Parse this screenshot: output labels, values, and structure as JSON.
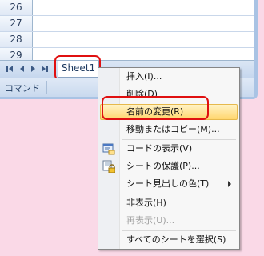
{
  "rows": [
    "26",
    "27",
    "28",
    "29"
  ],
  "nav": [
    "first",
    "prev",
    "next",
    "last"
  ],
  "sheet_tab": "Sheet1",
  "status_bar": {
    "label": "コマンド"
  },
  "menu": {
    "items": [
      {
        "label": "挿入(I)...",
        "icon": ""
      },
      {
        "label": "削除(D)",
        "icon": ""
      },
      {
        "label": "名前の変更(R)",
        "icon": "",
        "highlighted": true
      },
      {
        "label": "移動またはコピー(M)...",
        "icon": ""
      },
      {
        "label": "コードの表示(V)",
        "icon": "view-code-icon"
      },
      {
        "label": "シートの保護(P)...",
        "icon": "protect-sheet-icon"
      },
      {
        "label": "シート見出しの色(T)",
        "icon": "",
        "submenu": true
      },
      {
        "label": "非表示(H)",
        "icon": ""
      },
      {
        "label": "再表示(U)...",
        "icon": "",
        "disabled": true
      },
      {
        "label": "すべてのシートを選択(S)",
        "icon": ""
      }
    ]
  },
  "colors": {
    "background": "#fad9e7",
    "highlight_outline": "#e01010",
    "menu_highlight": "#ffd66e"
  }
}
